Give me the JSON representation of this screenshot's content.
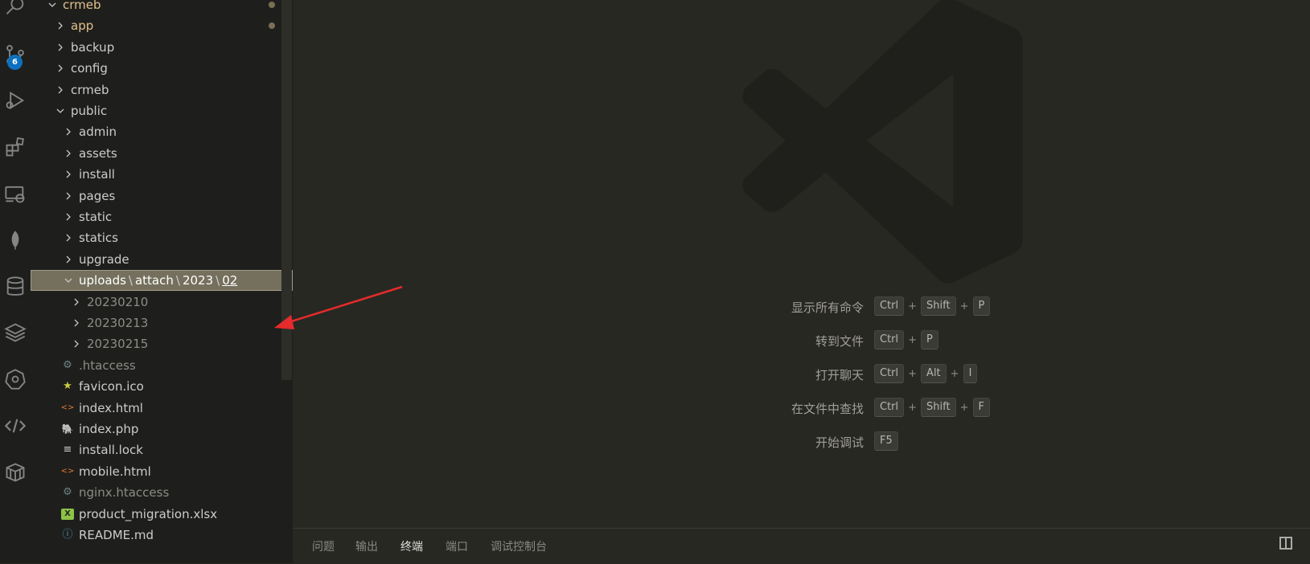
{
  "activity_bar": {
    "icons": [
      "search-icon",
      "source-control-icon",
      "run-debug-icon",
      "extensions-icon",
      "remote-explorer-icon",
      "mongodb-leaf-icon",
      "database-icon",
      "layers-icon",
      "kubernetes-icon",
      "api-icon",
      "docker-container-icon"
    ],
    "source_control_badge": "6"
  },
  "explorer": {
    "root": "crmeb",
    "folders_top": [
      "app",
      "backup",
      "config",
      "crmeb"
    ],
    "public_label": "public",
    "public_children": [
      "admin",
      "assets",
      "install",
      "pages",
      "static",
      "statics",
      "upgrade"
    ],
    "selected_path": {
      "parts": [
        "uploads",
        "attach",
        "2023"
      ],
      "last": "02",
      "separator": "\\"
    },
    "upload_children": [
      "20230210",
      "20230213",
      "20230215"
    ],
    "files": [
      {
        "name": ".htaccess",
        "icon": "gear-icon"
      },
      {
        "name": "favicon.ico",
        "icon": "star-icon"
      },
      {
        "name": "index.html",
        "icon": "html-code-icon"
      },
      {
        "name": "index.php",
        "icon": "php-elephant-icon"
      },
      {
        "name": "install.lock",
        "icon": "lines-icon"
      },
      {
        "name": "mobile.html",
        "icon": "html-code-icon"
      },
      {
        "name": "nginx.htaccess",
        "icon": "gear-icon"
      },
      {
        "name": "product_migration.xlsx",
        "icon": "excel-icon"
      },
      {
        "name": "README.md",
        "icon": "info-icon"
      }
    ]
  },
  "editor": {
    "shortcuts": [
      {
        "label": "显示所有命令",
        "keys": [
          "Ctrl",
          "Shift",
          "P"
        ]
      },
      {
        "label": "转到文件",
        "keys": [
          "Ctrl",
          "P"
        ]
      },
      {
        "label": "打开聊天",
        "keys": [
          "Ctrl",
          "Alt",
          "I"
        ]
      },
      {
        "label": "在文件中查找",
        "keys": [
          "Ctrl",
          "Shift",
          "F"
        ]
      },
      {
        "label": "开始调试",
        "keys": [
          "F5"
        ]
      }
    ]
  },
  "panel": {
    "tabs": [
      "问题",
      "输出",
      "终端",
      "端口",
      "调试控制台"
    ],
    "active_tab": "终端"
  },
  "colors": {
    "sidebar_bg": "#1e1f1c",
    "editor_bg": "#272822",
    "selection_bg": "#74705d",
    "modified_folder": "#e2c08d",
    "ignored_text": "#8c8c86",
    "annotation_arrow": "#e52b2b",
    "badge": "#0e70c0"
  }
}
